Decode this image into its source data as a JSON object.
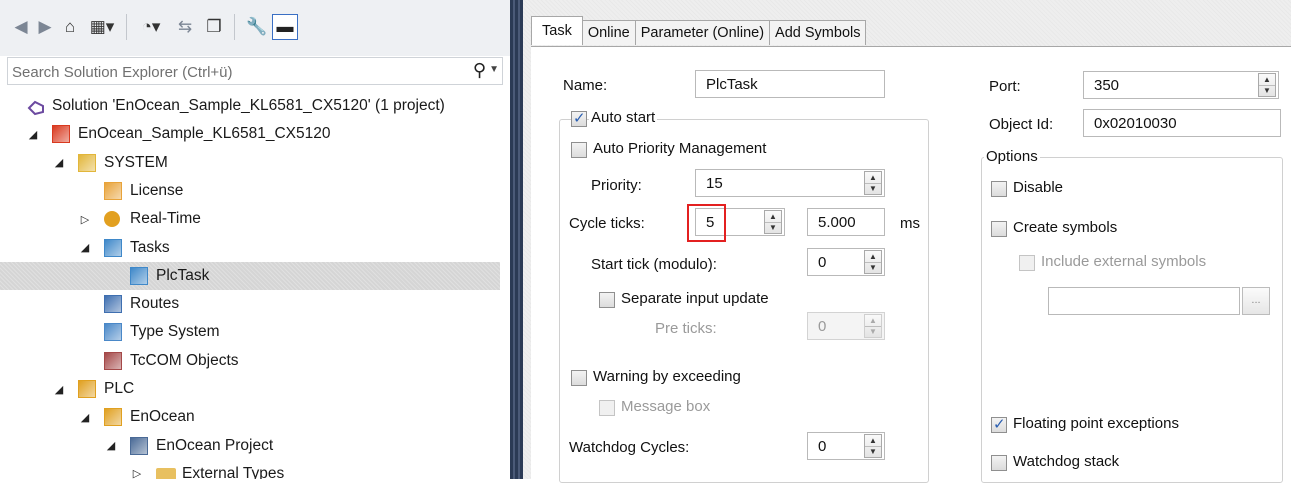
{
  "explorer": {
    "search_placeholder": "Search Solution Explorer (Ctrl+ü)",
    "tree": [
      {
        "label": "Solution 'EnOcean_Sample_KL6581_CX5120' (1 project)",
        "icon": "solution-icon",
        "expander": ""
      },
      {
        "label": "EnOcean_Sample_KL6581_CX5120",
        "icon": "twincat-project-icon",
        "expander": "◢"
      },
      {
        "label": "SYSTEM",
        "icon": "system-icon",
        "expander": "◢"
      },
      {
        "label": "License",
        "icon": "license-icon",
        "expander": ""
      },
      {
        "label": "Real-Time",
        "icon": "realtime-icon",
        "expander": "▷"
      },
      {
        "label": "Tasks",
        "icon": "tasks-icon",
        "expander": "◢"
      },
      {
        "label": "PlcTask",
        "icon": "task-icon",
        "expander": "",
        "selected": true
      },
      {
        "label": "Routes",
        "icon": "routes-icon",
        "expander": ""
      },
      {
        "label": "Type System",
        "icon": "type-system-icon",
        "expander": ""
      },
      {
        "label": "TcCOM Objects",
        "icon": "tccom-icon",
        "expander": ""
      },
      {
        "label": "PLC",
        "icon": "plc-icon",
        "expander": "◢"
      },
      {
        "label": "EnOcean",
        "icon": "plc-project-icon",
        "expander": "◢"
      },
      {
        "label": "EnOcean Project",
        "icon": "project-icon",
        "expander": "◢"
      },
      {
        "label": "External Types",
        "icon": "folder-icon",
        "expander": "▷"
      }
    ]
  },
  "tabs": [
    "Task",
    "Online",
    "Parameter (Online)",
    "Add Symbols"
  ],
  "task": {
    "name_label": "Name:",
    "name_value": "PlcTask",
    "auto_start_label": "Auto start",
    "auto_start": true,
    "auto_priority_label": "Auto Priority Management",
    "auto_priority": false,
    "priority_label": "Priority:",
    "priority_value": "15",
    "cycle_ticks_label": "Cycle ticks:",
    "cycle_ticks_value": "5",
    "cycle_time_value": "5.000",
    "cycle_time_unit": "ms",
    "start_tick_label": "Start tick (modulo):",
    "start_tick_value": "0",
    "separate_input_label": "Separate input update",
    "separate_input": false,
    "pre_ticks_label": "Pre ticks:",
    "pre_ticks_value": "0",
    "warning_label": "Warning by exceeding",
    "warning": false,
    "message_box_label": "Message box",
    "message_box": false,
    "watchdog_label": "Watchdog Cycles:",
    "watchdog_value": "0",
    "port_label": "Port:",
    "port_value": "350",
    "object_id_label": "Object Id:",
    "object_id_value": "0x02010030",
    "options_label": "Options",
    "disable_label": "Disable",
    "create_symbols_label": "Create symbols",
    "include_external_label": "Include external symbols",
    "floating_point_label": "Floating point exceptions",
    "floating_point": true,
    "watchdog_stack_label": "Watchdog stack",
    "browse_label": "..."
  },
  "colors": {
    "splitter": "#2b3a55",
    "highlight": "#e32020",
    "selection": "#d5d5d5"
  }
}
